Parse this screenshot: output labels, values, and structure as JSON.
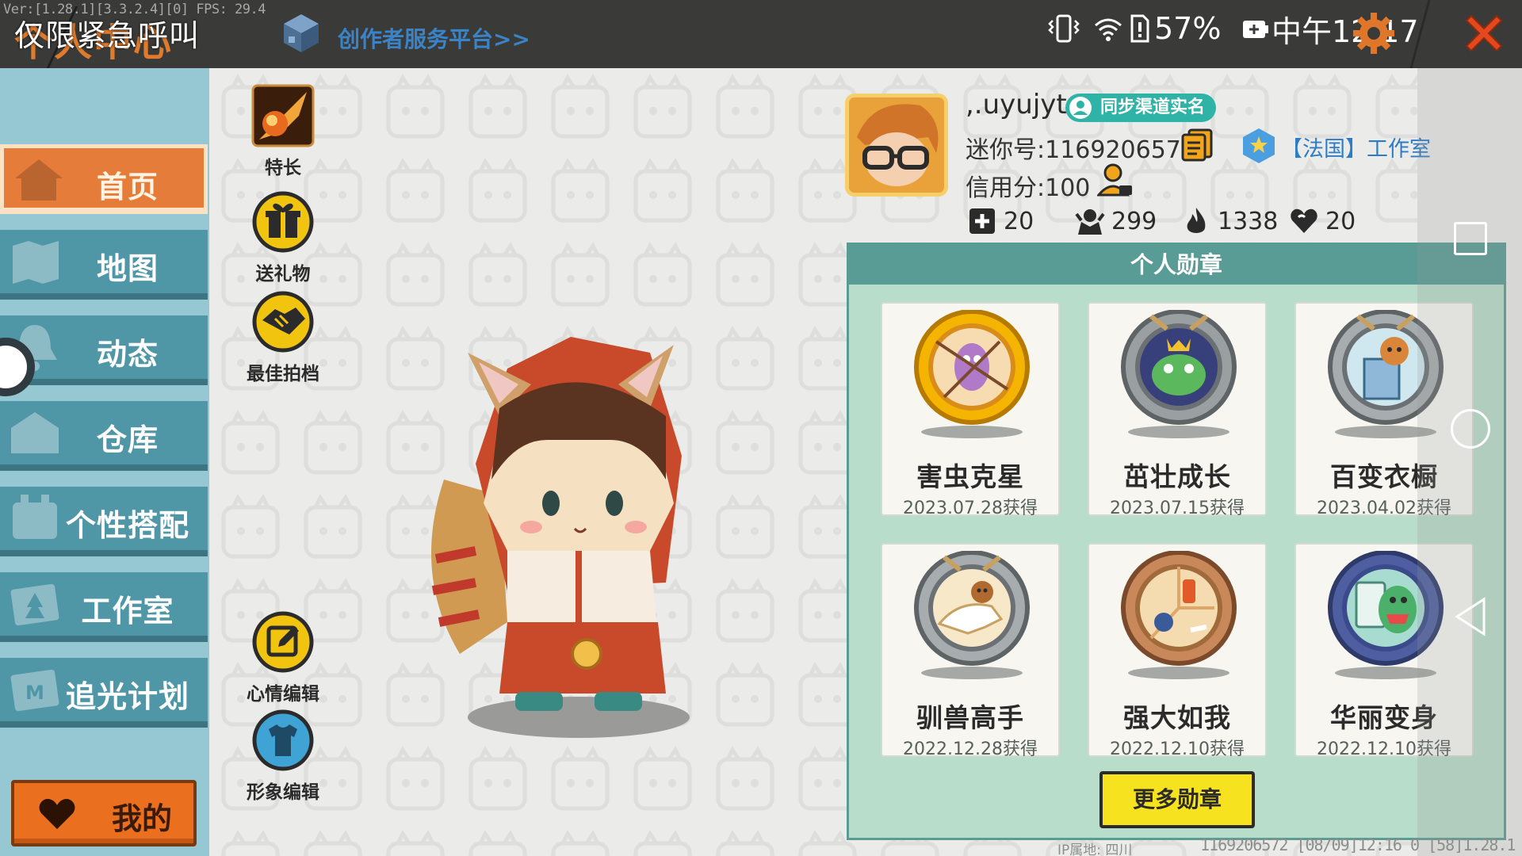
{
  "debug": {
    "version_text": "Ver:[1.28.1][3.3.2.4][0] FPS: 29.4"
  },
  "header": {
    "title": "个人中心",
    "overlay_text": "仅限紧急呼叫",
    "creator_link": "创作者服务平台>>"
  },
  "status_bar": {
    "battery": "57%",
    "time": "中午12:17"
  },
  "sidebar": {
    "items": [
      {
        "label": "首页",
        "icon": "home-icon"
      },
      {
        "label": "地图",
        "icon": "map-icon"
      },
      {
        "label": "动态",
        "icon": "bell-icon"
      },
      {
        "label": "仓库",
        "icon": "warehouse-icon"
      },
      {
        "label": "个性搭配",
        "icon": "outfit-icon"
      },
      {
        "label": "工作室",
        "icon": "studio-icon"
      },
      {
        "label": "追光计划",
        "icon": "spotlight-icon"
      }
    ],
    "active": "首页",
    "my_button": "我的"
  },
  "actions": {
    "specialty": "特长",
    "gift": "送礼物",
    "partner": "最佳拍档",
    "mood": "心情编辑",
    "appearance": "形象编辑"
  },
  "profile": {
    "username": ",.uyujyt",
    "realname_badge": "同步渠道实名",
    "mini_id": "迷你号:1169206572",
    "studio": "【法国】工作室",
    "credit": "信用分:100",
    "stats": {
      "add": "20",
      "fans": "299",
      "heat": "1338",
      "likes": "20"
    }
  },
  "medals": {
    "title": "个人勋章",
    "items": [
      {
        "name": "害虫克星",
        "date": "2023.07.28获得",
        "icon": "pest-medal-icon"
      },
      {
        "name": "茁壮成长",
        "date": "2023.07.15获得",
        "icon": "growth-medal-icon"
      },
      {
        "name": "百变衣橱",
        "date": "2023.04.02获得",
        "icon": "wardrobe-medal-icon"
      },
      {
        "name": "驯兽高手",
        "date": "2022.12.28获得",
        "icon": "tamer-medal-icon"
      },
      {
        "name": "强大如我",
        "date": "2022.12.10获得",
        "icon": "strong-medal-icon"
      },
      {
        "name": "华丽变身",
        "date": "2022.12.10获得",
        "icon": "transform-medal-icon"
      }
    ],
    "more_button": "更多勋章"
  },
  "footer": {
    "ip": "IP属地: 四川",
    "debug": "1169206572  [08/09]12:16 0  [58]1.28.1"
  },
  "colors": {
    "accent_orange": "#e57c3a",
    "nav_teal": "#4f96a7",
    "panel_green": "#b8ddca",
    "button_yellow": "#f6e21e"
  }
}
